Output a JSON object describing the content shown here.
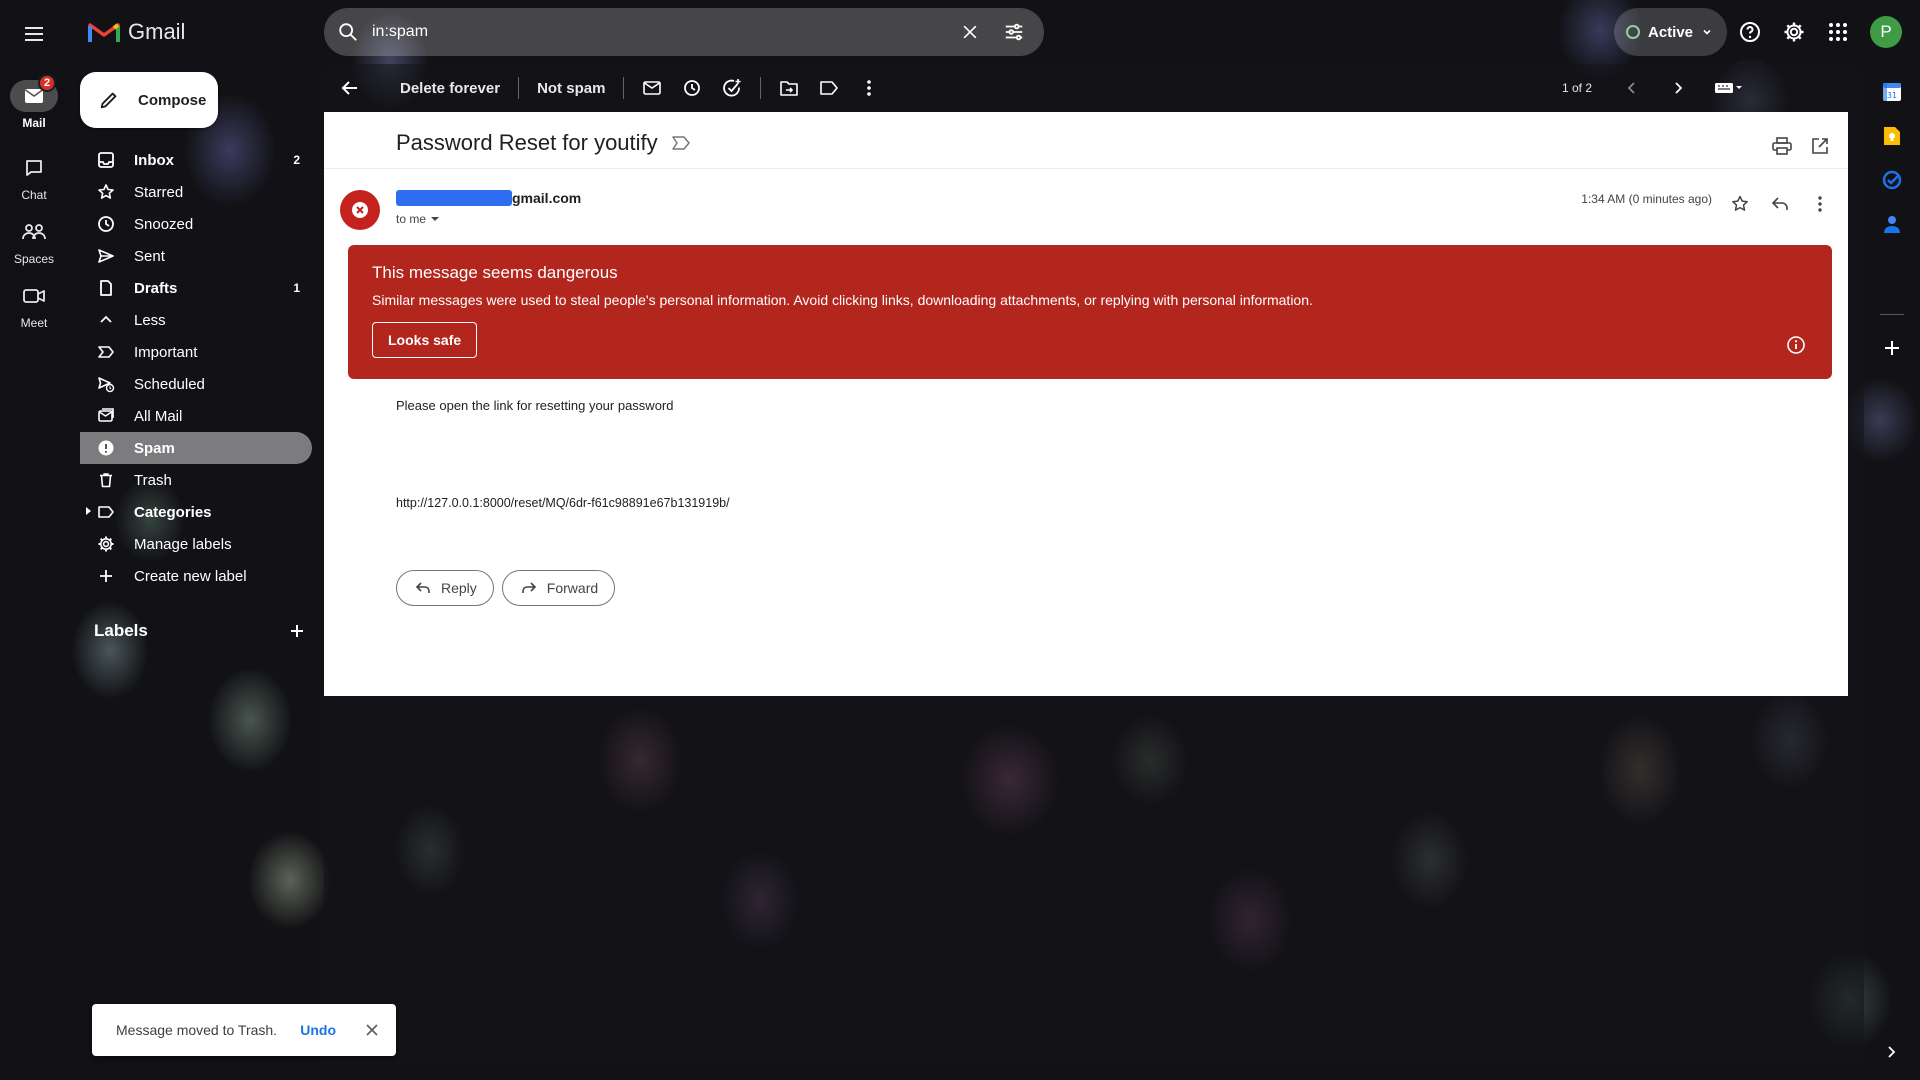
{
  "app": {
    "name": "Gmail"
  },
  "search": {
    "value": "in:spam"
  },
  "header": {
    "status": "Active",
    "avatar_letter": "P"
  },
  "rail": {
    "items": [
      {
        "label": "Mail",
        "badge": "2"
      },
      {
        "label": "Chat"
      },
      {
        "label": "Spaces"
      },
      {
        "label": "Meet"
      }
    ]
  },
  "compose": {
    "label": "Compose"
  },
  "nav": {
    "items": [
      {
        "label": "Inbox",
        "count": "2"
      },
      {
        "label": "Starred"
      },
      {
        "label": "Snoozed"
      },
      {
        "label": "Sent"
      },
      {
        "label": "Drafts",
        "count": "1"
      },
      {
        "label": "Less"
      },
      {
        "label": "Important"
      },
      {
        "label": "Scheduled"
      },
      {
        "label": "All Mail"
      },
      {
        "label": "Spam"
      },
      {
        "label": "Trash"
      },
      {
        "label": "Categories"
      },
      {
        "label": "Manage labels"
      },
      {
        "label": "Create new label"
      }
    ],
    "labels_title": "Labels"
  },
  "toolbar": {
    "delete_forever": "Delete forever",
    "not_spam": "Not spam",
    "pager": "1 of 2"
  },
  "email": {
    "subject": "Password Reset for youtify",
    "sender_suffix": "gmail.com",
    "to": "to me",
    "time": "1:34 AM (0 minutes ago)",
    "warning_title": "This message seems dangerous",
    "warning_body": "Similar messages were used to steal people's personal information. Avoid clicking links, downloading attachments, or replying with personal information.",
    "looks_safe": "Looks safe",
    "body": "Please open the link for resetting your password",
    "link": "http://127.0.0.1:8000/reset/MQ/6dr-f61c98891e67b131919b/",
    "reply": "Reply",
    "forward": "Forward"
  },
  "snackbar": {
    "message": "Message moved to Trash.",
    "undo": "Undo"
  },
  "colors": {
    "danger": "#b3261e",
    "accent": "#1a73e8",
    "avatar": "#3f9b44"
  }
}
